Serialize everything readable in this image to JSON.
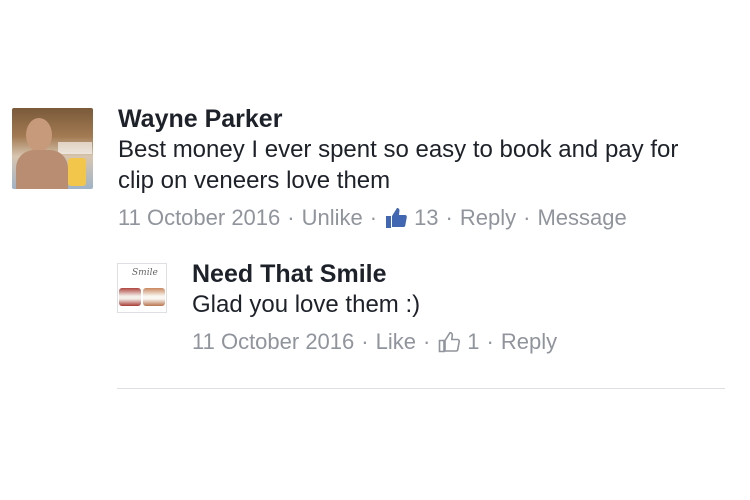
{
  "comment": {
    "author": "Wayne Parker",
    "text": "Best money I ever spent so easy to book and pay for clip on veneers love them",
    "date": "11 October 2016",
    "like_action": "Unlike",
    "like_count": "13",
    "reply_action": "Reply",
    "message_action": "Message",
    "avatar_icon": "user-photo"
  },
  "reply": {
    "author": "Need That Smile",
    "text": "Glad you love them :)",
    "date": "11 October 2016",
    "like_action": "Like",
    "like_count": "1",
    "reply_action": "Reply",
    "avatar_logo_text": "Smile",
    "avatar_icon": "page-logo"
  },
  "meta_separator": "·",
  "colors": {
    "thumb_blue": "#4267b2",
    "meta_gray": "#90949c",
    "text_dark": "#1d2129"
  }
}
